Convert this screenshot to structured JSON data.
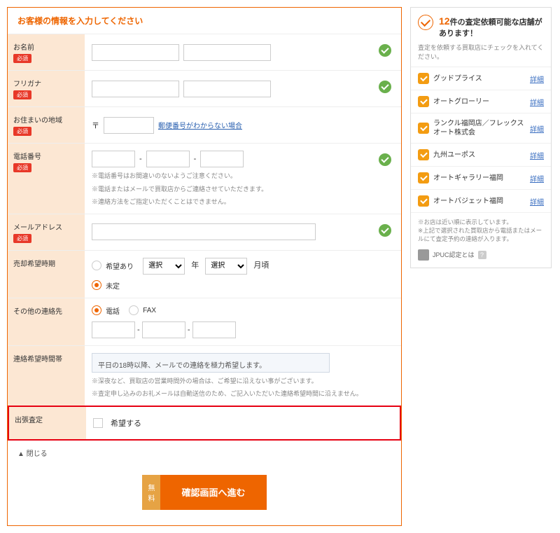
{
  "form": {
    "title": "お客様の情報を入力してください",
    "required_label": "必須",
    "name_label": "お名前",
    "furigana_label": "フリガナ",
    "region_label": "お住まいの地域",
    "post_prefix": "〒",
    "post_unknown": "郵便番号がわからない場合",
    "phone_label": "電話番号",
    "phone_note1": "※電話番号はお間違いのないようご注意ください。",
    "phone_note2": "※電話またはメールで買取店からご連絡させていただきます。",
    "phone_note3": "※連絡方法をご指定いただくことはできません。",
    "email_label": "メールアドレス",
    "timing_label": "売却希望時期",
    "timing_yes": "希望あり",
    "timing_no": "未定",
    "timing_select": "選択",
    "timing_year": "年",
    "timing_month": "月頃",
    "other_contact_label": "その他の連絡先",
    "other_contact_phone": "電話",
    "other_contact_fax": "FAX",
    "contact_time_label": "連絡希望時間帯",
    "contact_msg": "平日の18時以降、メールでの連絡を極力希望します。",
    "contact_note1": "※深夜など、買取店の営業時間外の場合は、ご希望に沿えない事がございます。",
    "contact_note2": "※査定申し込みのお礼メールは自動送信のため、ご記入いただいた連絡希望時間に沿えません。",
    "visit_label": "出張査定",
    "visit_hope": "希望する",
    "close": "▲ 閉じる",
    "submit_free1": "無",
    "submit_free2": "料",
    "submit_main": "確認画面へ進む"
  },
  "side": {
    "count": "12",
    "head_suffix": "件の査定依頼可能な店舗があります！",
    "sub": "査定を依頼する買取店にチェックを入れてください。",
    "detail": "詳細",
    "shops": [
      {
        "name": "グッドプライス"
      },
      {
        "name": "オートグローリー"
      },
      {
        "name": "ランクル福岡店／フレックスオート株式会"
      },
      {
        "name": "九州ユーポス"
      },
      {
        "name": "オートギャラリー福岡"
      },
      {
        "name": "オートバジェット福岡"
      }
    ],
    "footnote": "※お店は近い順に表示しています。\n※上記で選択された買取店から電話またはメールにて査定予約の連絡が入ります。",
    "jpuc": "JPUC認定とは"
  }
}
